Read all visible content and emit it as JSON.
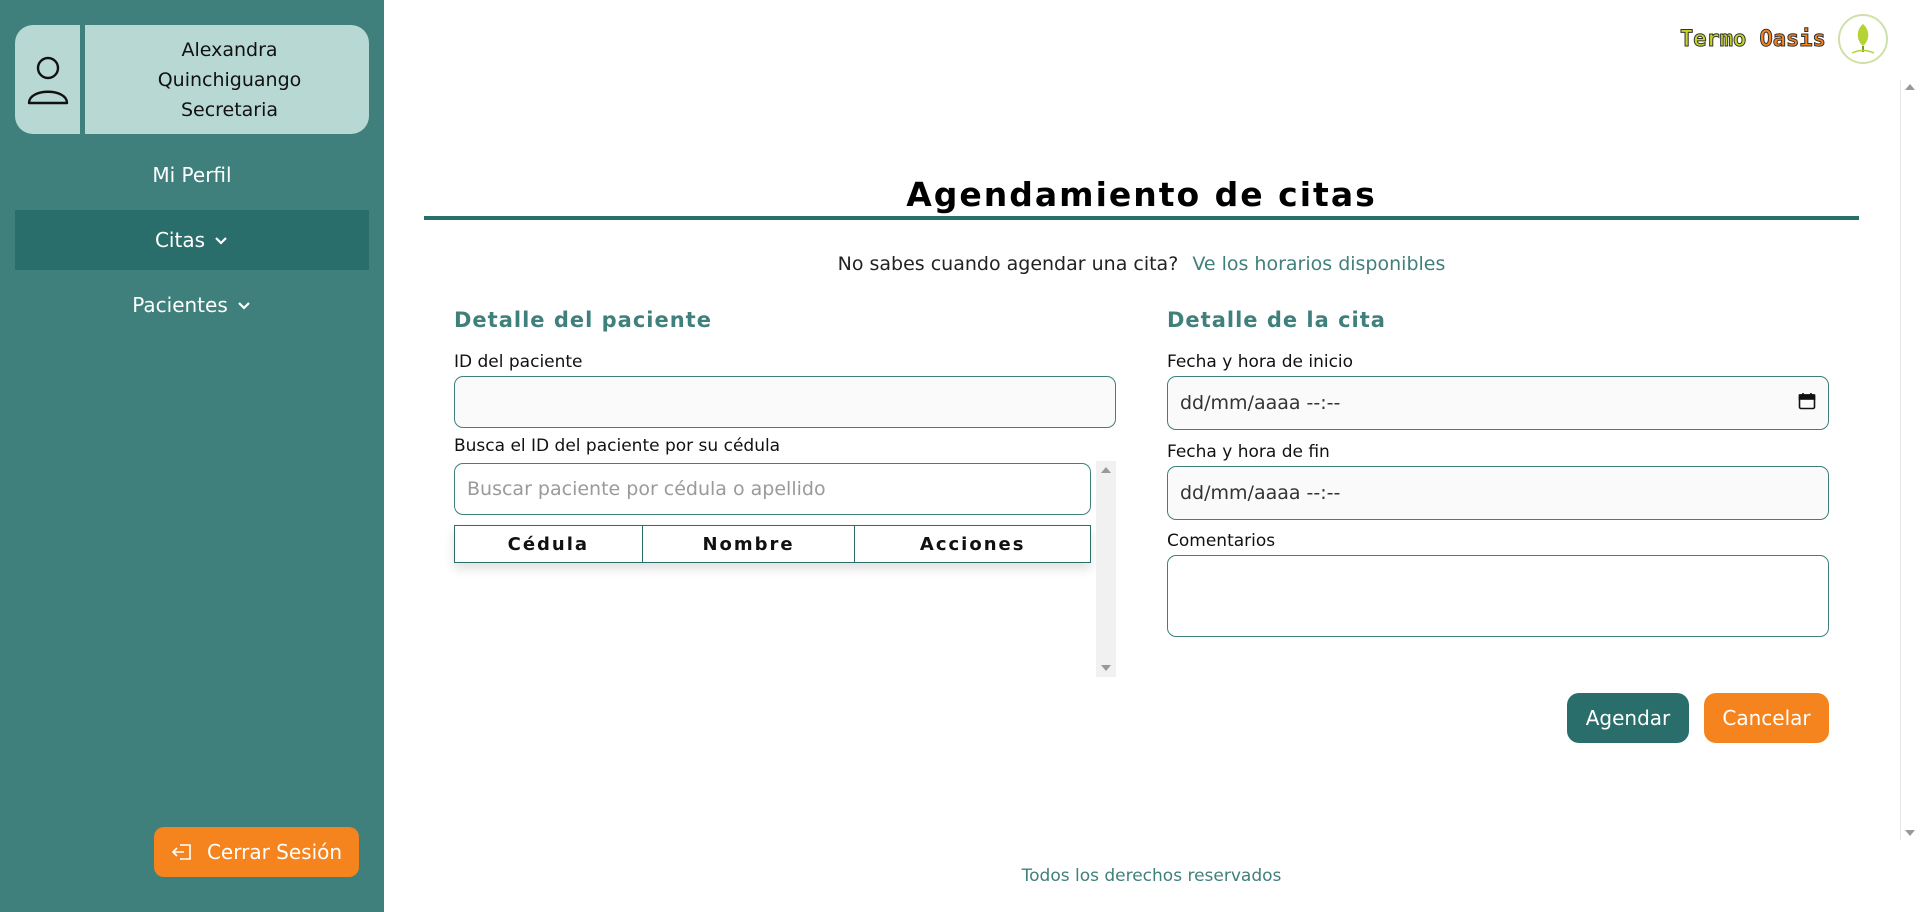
{
  "sidebar": {
    "user": {
      "first_name": "Alexandra",
      "last_name": "Quinchiguango",
      "role": "Secretaria"
    },
    "nav": [
      {
        "label": "Mi Perfil",
        "has_chevron": false
      },
      {
        "label": "Citas",
        "has_chevron": true,
        "active": true
      },
      {
        "label": "Pacientes",
        "has_chevron": true
      }
    ],
    "logout_label": "Cerrar Sesión"
  },
  "brand": {
    "word1": "Termo",
    "word2": "Oasis"
  },
  "main": {
    "title": "Agendamiento de citas",
    "subtitle": "No sabes cuando agendar una cita?",
    "subtitle_link": "Ve los horarios disponibles",
    "patient_section": {
      "title": "Detalle del paciente",
      "id_label": "ID del paciente",
      "id_value": "",
      "search_label": "Busca el ID del paciente por su cédula",
      "search_placeholder": "Buscar paciente por cédula o apellido",
      "table_headers": [
        "Cédula",
        "Nombre",
        "Acciones"
      ]
    },
    "appointment_section": {
      "title": "Detalle de la cita",
      "start_label": "Fecha y hora de inicio",
      "start_value": "dd/mm/aaaa --:--",
      "end_label": "Fecha y hora de fin",
      "end_value": "dd/mm/aaaa --:--",
      "comments_label": "Comentarios",
      "comments_value": ""
    },
    "actions": {
      "submit": "Agendar",
      "cancel": "Cancelar"
    }
  },
  "footer": {
    "text": "Todos los derechos reservados"
  },
  "colors": {
    "sidebar": "#3f807c",
    "sidebar_active": "#2a6e6c",
    "user_card": "#b8d8d3",
    "accent_orange": "#f5841f",
    "teal": "#3f807c"
  }
}
